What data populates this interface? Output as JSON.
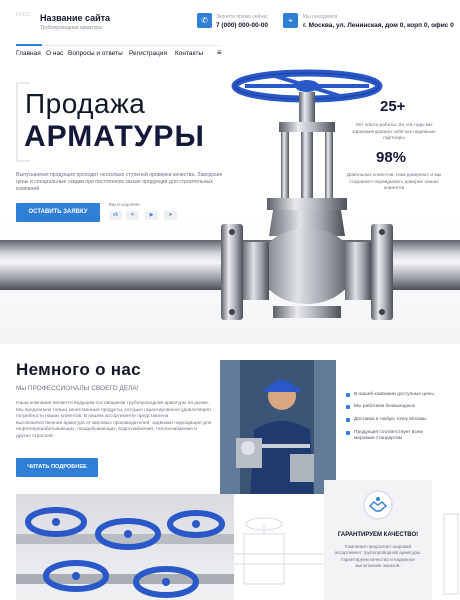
{
  "header": {
    "logo_text": "LOGO",
    "site_title": "Название сайта",
    "site_subtitle": "Трубопроводная арматура",
    "phone_label": "Звоните прямо сейчас",
    "phone_value": "7 (000) 000-00-00",
    "address_label": "Мы находимся",
    "address_value": "г. Москва, ул. Ленинская, дом 0, корп 0, офис 0"
  },
  "nav": {
    "items": [
      "Главная",
      "О нас",
      "Вопросы и ответы",
      "Регистрация",
      "Контакты"
    ],
    "menu_icon": "≡"
  },
  "hero": {
    "line1": "Продажа",
    "line2": "АРМАТУРЫ",
    "description": "Выпускаемая продукция проходит несколько ступеней проверки качества. Заводские цены и специальные скидки при постоянном заказе продукции для строительных компаний",
    "cta_label": "ОСТАВИТЬ ЗАЯВКУ",
    "social_label": "Мы в соцсетях",
    "social": [
      "vk",
      "tw",
      "yt",
      "tg"
    ]
  },
  "stats": [
    {
      "value": "25+",
      "text": "Лет опыта работы. За эти годы мы зарекомендовали себя как надежные партнеры"
    },
    {
      "value": "98%",
      "text": "Довольных клиентов. Нам доверяют, и мы стараемся оправдывать доверие наших клиентов"
    }
  ],
  "about": {
    "title": "Немного о нас",
    "subtitle": "Мы ПРОФЕССИОНАЛЫ СВОЕГО ДЕЛА!",
    "text": "Наша компания является ведущим поставщиком трубопроводной арматуры на рынке. Мы предлагаем только качественные продукты, которые гарантированно удовлетворят потребности наших клиентов. В нашем ассортименте представлена высококачественная арматура от мировых производителей, задвижки подходящие для нефтеперерабатывающих, газодобывающих, водоснабжения, теплоснабжения и других отраслей.",
    "button_label": "ЧИТАТЬ ПОДРОБНЕЕ",
    "checklist": [
      "В нашей компании доступные цены",
      "Мы работаем безвыходных",
      "Доставка в любую точку Москвы",
      "Продукция соответствует всем мировым стандартам"
    ]
  },
  "guarantee": {
    "title": "ГАРАНТИРУЕМ КАЧЕСТВО!",
    "text": "Компания предлагает широкий ассортимент трубопроводной арматуры. Гарантируем качество и надежное выполнение заказов."
  },
  "colors": {
    "accent": "#2f7fd7",
    "dark": "#14193a",
    "valve_blue": "#2a58c9"
  }
}
